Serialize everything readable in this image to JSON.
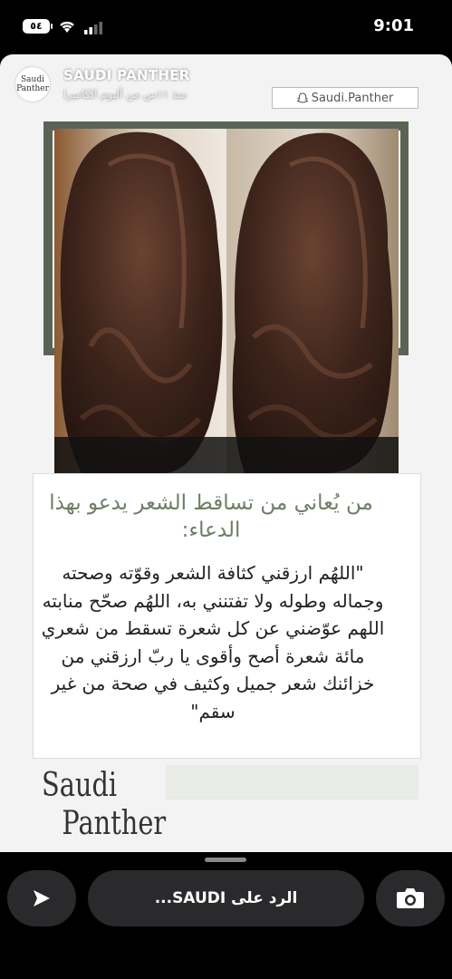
{
  "status_bar": {
    "time": "9:01",
    "battery": "٥٤"
  },
  "story": {
    "account_name": "SAUDI PANTHER",
    "subtitle": "منذ ١١س من ألبوم الكاميرا",
    "avatar_text": "Saudi Panther",
    "snap_handle": "Saudi.Panther"
  },
  "content": {
    "title": "من يُعاني من تساقط الشعر يدعو بهذا الدعاء:",
    "body": "\"اللهُم ارزقني كثافة الشعر وقوّته وصحته وجماله وطوله ولا تفتنني به، اللهُم صحّح منابته اللهم عوّضني عن كل شعرة تسقط من شعري مائة شعرة أصح وأقوى يا ربّ ارزقني من خزائنك شعر جميل وكثيف في صحة من غير سقم\""
  },
  "brand": {
    "line1": "Saudi",
    "line2": "Panther"
  },
  "bottom_bar": {
    "reply_placeholder": "الرد على SAUDI..."
  },
  "colors": {
    "accent": "#6e7e64",
    "frame": "#5a6456",
    "hair": "#3b2219"
  }
}
